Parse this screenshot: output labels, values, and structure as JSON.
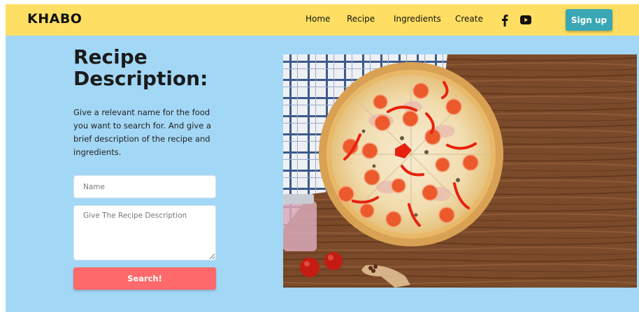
{
  "navbar": {
    "brand": "KHABO",
    "links": [
      "Home",
      "Recipe",
      "Ingredients",
      "Create"
    ],
    "social_icons": [
      "facebook-icon",
      "youtube-icon"
    ],
    "signup_label": "Sign up",
    "background": "#fedf63",
    "signup_color": "#3aa8b4"
  },
  "hero": {
    "title_line1": "Recipe",
    "title_line2": "Description:",
    "description": "Give a relevant name for the food you want to search for. And give a brief description of the recipe and ingredients.",
    "name_placeholder": "Name",
    "description_placeholder": "Give The Recipe Description",
    "search_label": "Search!",
    "background": "#a3d7f6",
    "search_color": "#fe6a6b"
  },
  "image": {
    "subject": "pizza-photo"
  }
}
